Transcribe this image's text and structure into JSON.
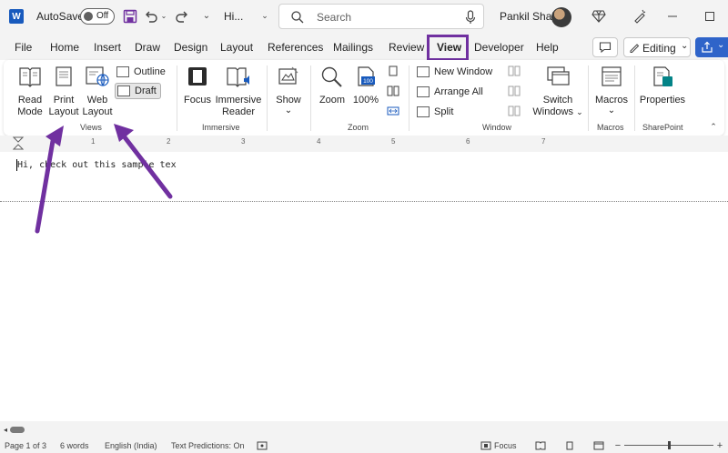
{
  "titlebar": {
    "app_logo": "W",
    "autosave_label": "AutoSave",
    "autosave_state": "Off",
    "doc_title": "Hi...",
    "search_placeholder": "Search",
    "user_name": "Pankil Shah"
  },
  "tabs": [
    "File",
    "Home",
    "Insert",
    "Draw",
    "Design",
    "Layout",
    "References",
    "Mailings",
    "Review",
    "View",
    "Developer",
    "Help"
  ],
  "active_tab": "View",
  "editing_label": "Editing",
  "ribbon": {
    "views": {
      "read_mode": [
        "Read",
        "Mode"
      ],
      "print_layout": [
        "Print",
        "Layout"
      ],
      "web_layout": [
        "Web",
        "Layout"
      ],
      "outline": "Outline",
      "draft": "Draft",
      "group_label": "Views"
    },
    "immersive": {
      "focus": "Focus",
      "immersive_reader": [
        "Immersive",
        "Reader"
      ],
      "group_label": "Immersive"
    },
    "show": {
      "label": "Show"
    },
    "zoom": {
      "zoom": "Zoom",
      "hundred": "100%",
      "hundred_icon_text": "100",
      "group_label": "Zoom"
    },
    "window": {
      "new_window": "New Window",
      "arrange_all": "Arrange All",
      "split": "Split",
      "switch_windows": [
        "Switch",
        "Windows"
      ],
      "group_label": "Window"
    },
    "macros": {
      "label": "Macros",
      "group_label": "Macros"
    },
    "sharepoint": {
      "properties": "Properties",
      "group_label": "SharePoint"
    }
  },
  "ruler_numbers": [
    "1",
    "2",
    "3",
    "4",
    "5",
    "6",
    "7"
  ],
  "document": {
    "text": "Hi, check out this sample tex"
  },
  "statusbar": {
    "page": "Page 1 of 3",
    "words": "6 words",
    "language": "English (India)",
    "predictions": "Text Predictions: On",
    "focus": "Focus"
  },
  "colors": {
    "highlight": "#7030a0",
    "word_blue": "#185abd",
    "arrow": "#7030a0"
  }
}
